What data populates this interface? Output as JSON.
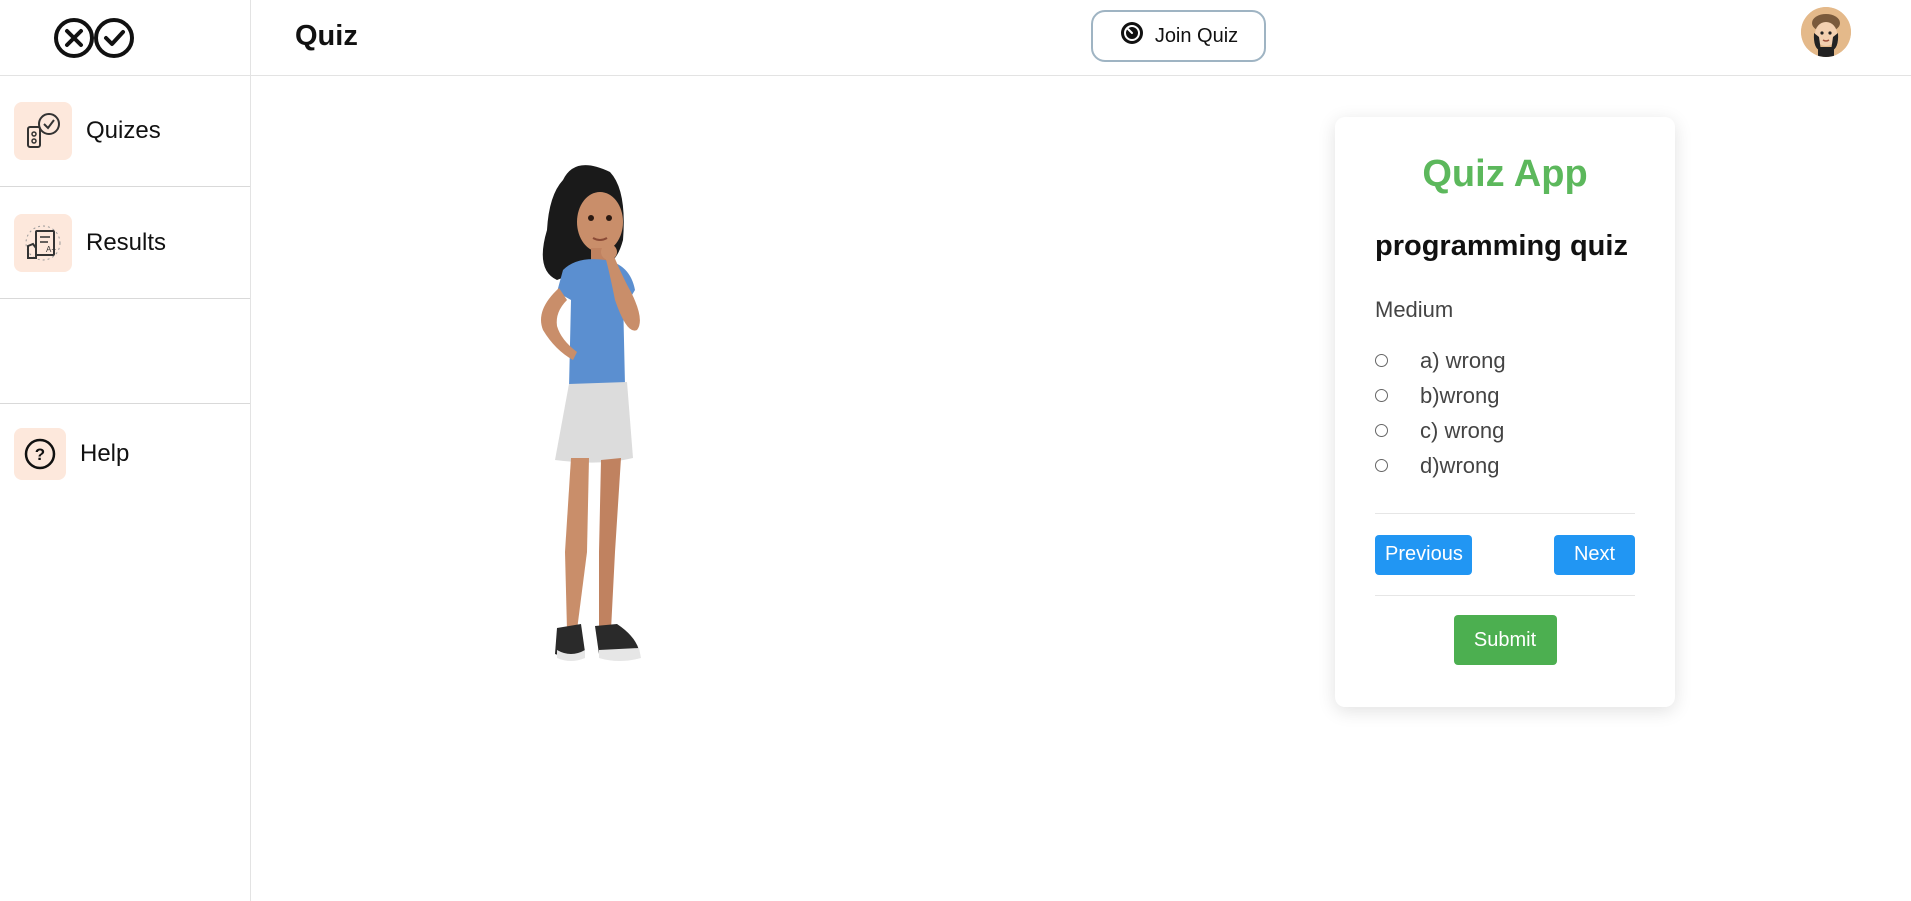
{
  "header": {
    "title": "Quiz",
    "join_button": "Join Quiz"
  },
  "sidebar": {
    "items": [
      {
        "label": "Quizes",
        "icon": "quiz-icon"
      },
      {
        "label": "Results",
        "icon": "results-icon"
      },
      {
        "label": "Help",
        "icon": "help-icon"
      }
    ]
  },
  "card": {
    "app_title": "Quiz App",
    "quiz_name": "programming quiz",
    "difficulty": "Medium",
    "options": [
      "a) wrong",
      "b)wrong",
      "c) wrong",
      "d)wrong"
    ],
    "previous_label": "Previous",
    "next_label": "Next",
    "submit_label": "Submit"
  },
  "colors": {
    "accent_green": "#5cb85c",
    "button_blue": "#2196f3",
    "submit_green": "#4caf50",
    "icon_bg": "#fde8dc"
  }
}
